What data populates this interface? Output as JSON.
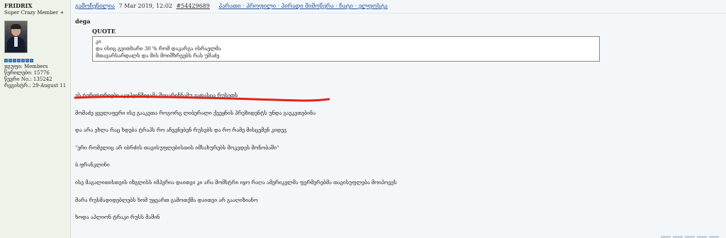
{
  "author": {
    "name": "FRIDRIX",
    "rank": "Super Crazy Member +",
    "group": "ჯგუფი: Members",
    "posts": "წერილები: 15776",
    "member_no": "წევრი No.: 135242",
    "registered": "რეგისტრ.: 29-August 11",
    "pip_count": 7
  },
  "header": {
    "profile_link": "გამოჩენილია",
    "date": "7 Mar 2019, 12:02",
    "post_id": "#54429689",
    "actions": "პარათი · პროფილი · პირადი მიმოწერა · ჩატი · ელფოსტა"
  },
  "post": {
    "poster": "dega",
    "quote_label": "QUOTE",
    "quote_lines": [
      "კი",
      "და ისიც გვითხარი 30 % რომ დაკარგა ისრაელმა",
      "მთავარსარდალს და მის მოიშხრეებს რას უშაძე"
    ],
    "lines": [
      "ეს ტერიტორიები აკუპეინშიყამა შეცარიჩნამუ გადასცა რუსეთს",
      "მომაძე ყველაფერი ისე გააკეთა როგორც ლიბერალი ქვეყნის პრეზიდენტს უნდა გაეკეთებინა",
      "და არა ეხლა რაც ხდება ტრაპს რო აჩვენებენ რუსებს და რო რამე მისცემენ კიდევ",
      "\"ერი რომელიც არ იბრძის თავისუფლებისთის იმსახურებს მოკვდეს მონობაში\"",
      "ბ.ფრანკლინი",
      "ისე მაგალითისთვის იზგლისს იმპერია დაითვი კი არა მომსტრი იყო რაღა ამერიკელმა ფერმერებმა თავისუფლება მოიპოვეს",
      "მარა რუსმადიდებლებს ხომ უყვართ გამოთქმა დაითვი არ გააღიზიანო",
      "ხოდა აპლიონ ტრაკი რუსს მაშინ"
    ]
  }
}
